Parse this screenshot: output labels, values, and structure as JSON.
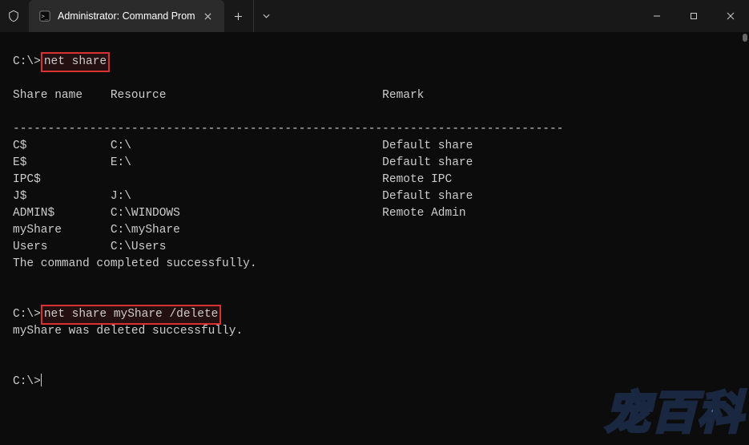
{
  "titlebar": {
    "tab_title": "Administrator: Command Prom",
    "shield_icon": "shield",
    "cmd_icon": "cmd"
  },
  "terminal": {
    "prompt1_prefix": "C:\\>",
    "cmd1": "net share",
    "header_share": "Share name",
    "header_resource": "Resource",
    "header_remark": "Remark",
    "divider": "-------------------------------------------------------------------------------",
    "rows": [
      {
        "name": "C$",
        "resource": "C:\\",
        "remark": "Default share"
      },
      {
        "name": "E$",
        "resource": "E:\\",
        "remark": "Default share"
      },
      {
        "name": "IPC$",
        "resource": "",
        "remark": "Remote IPC"
      },
      {
        "name": "J$",
        "resource": "J:\\",
        "remark": "Default share"
      },
      {
        "name": "ADMIN$",
        "resource": "C:\\WINDOWS",
        "remark": "Remote Admin"
      },
      {
        "name": "myShare",
        "resource": "C:\\myShare",
        "remark": ""
      },
      {
        "name": "Users",
        "resource": "C:\\Users",
        "remark": ""
      }
    ],
    "success1": "The command completed successfully.",
    "prompt2_prefix": "C:\\>",
    "cmd2": "net share myShare /delete",
    "success2": "myShare was deleted successfully.",
    "prompt3": "C:\\>",
    "watermark": "宠百科"
  }
}
